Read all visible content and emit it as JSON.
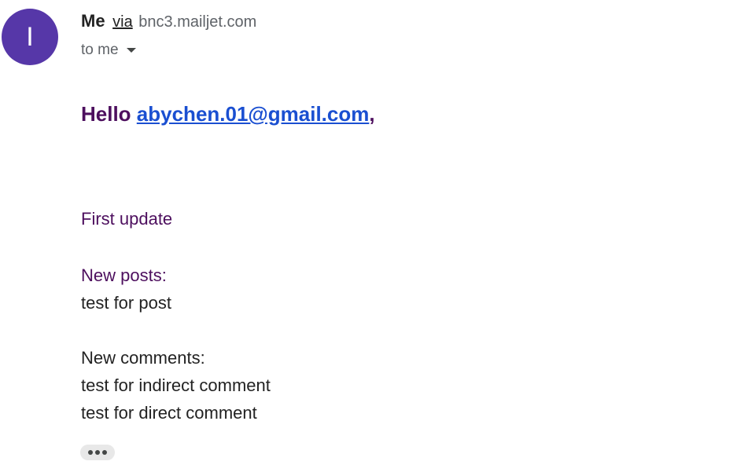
{
  "sender": {
    "avatar_letter": "I",
    "name": "Me",
    "via_label": "via",
    "domain": "bnc3.mailjet.com"
  },
  "recipient": {
    "label": "to me"
  },
  "body": {
    "greeting_prefix": "Hello ",
    "greeting_email": "abychen.01@gmail.com",
    "greeting_suffix": ",",
    "title": "First update",
    "posts_heading": "New posts:",
    "posts": [
      "test for post"
    ],
    "comments_heading": "New comments:",
    "comments": [
      "test for indirect comment",
      "test for direct comment"
    ]
  },
  "colors": {
    "avatar_bg": "#5637a8",
    "accent_purple": "#4d0f5e",
    "link_blue": "#1a4fd1"
  },
  "icons": {
    "expand": "chevron-down-icon",
    "more": "ellipsis-icon"
  }
}
